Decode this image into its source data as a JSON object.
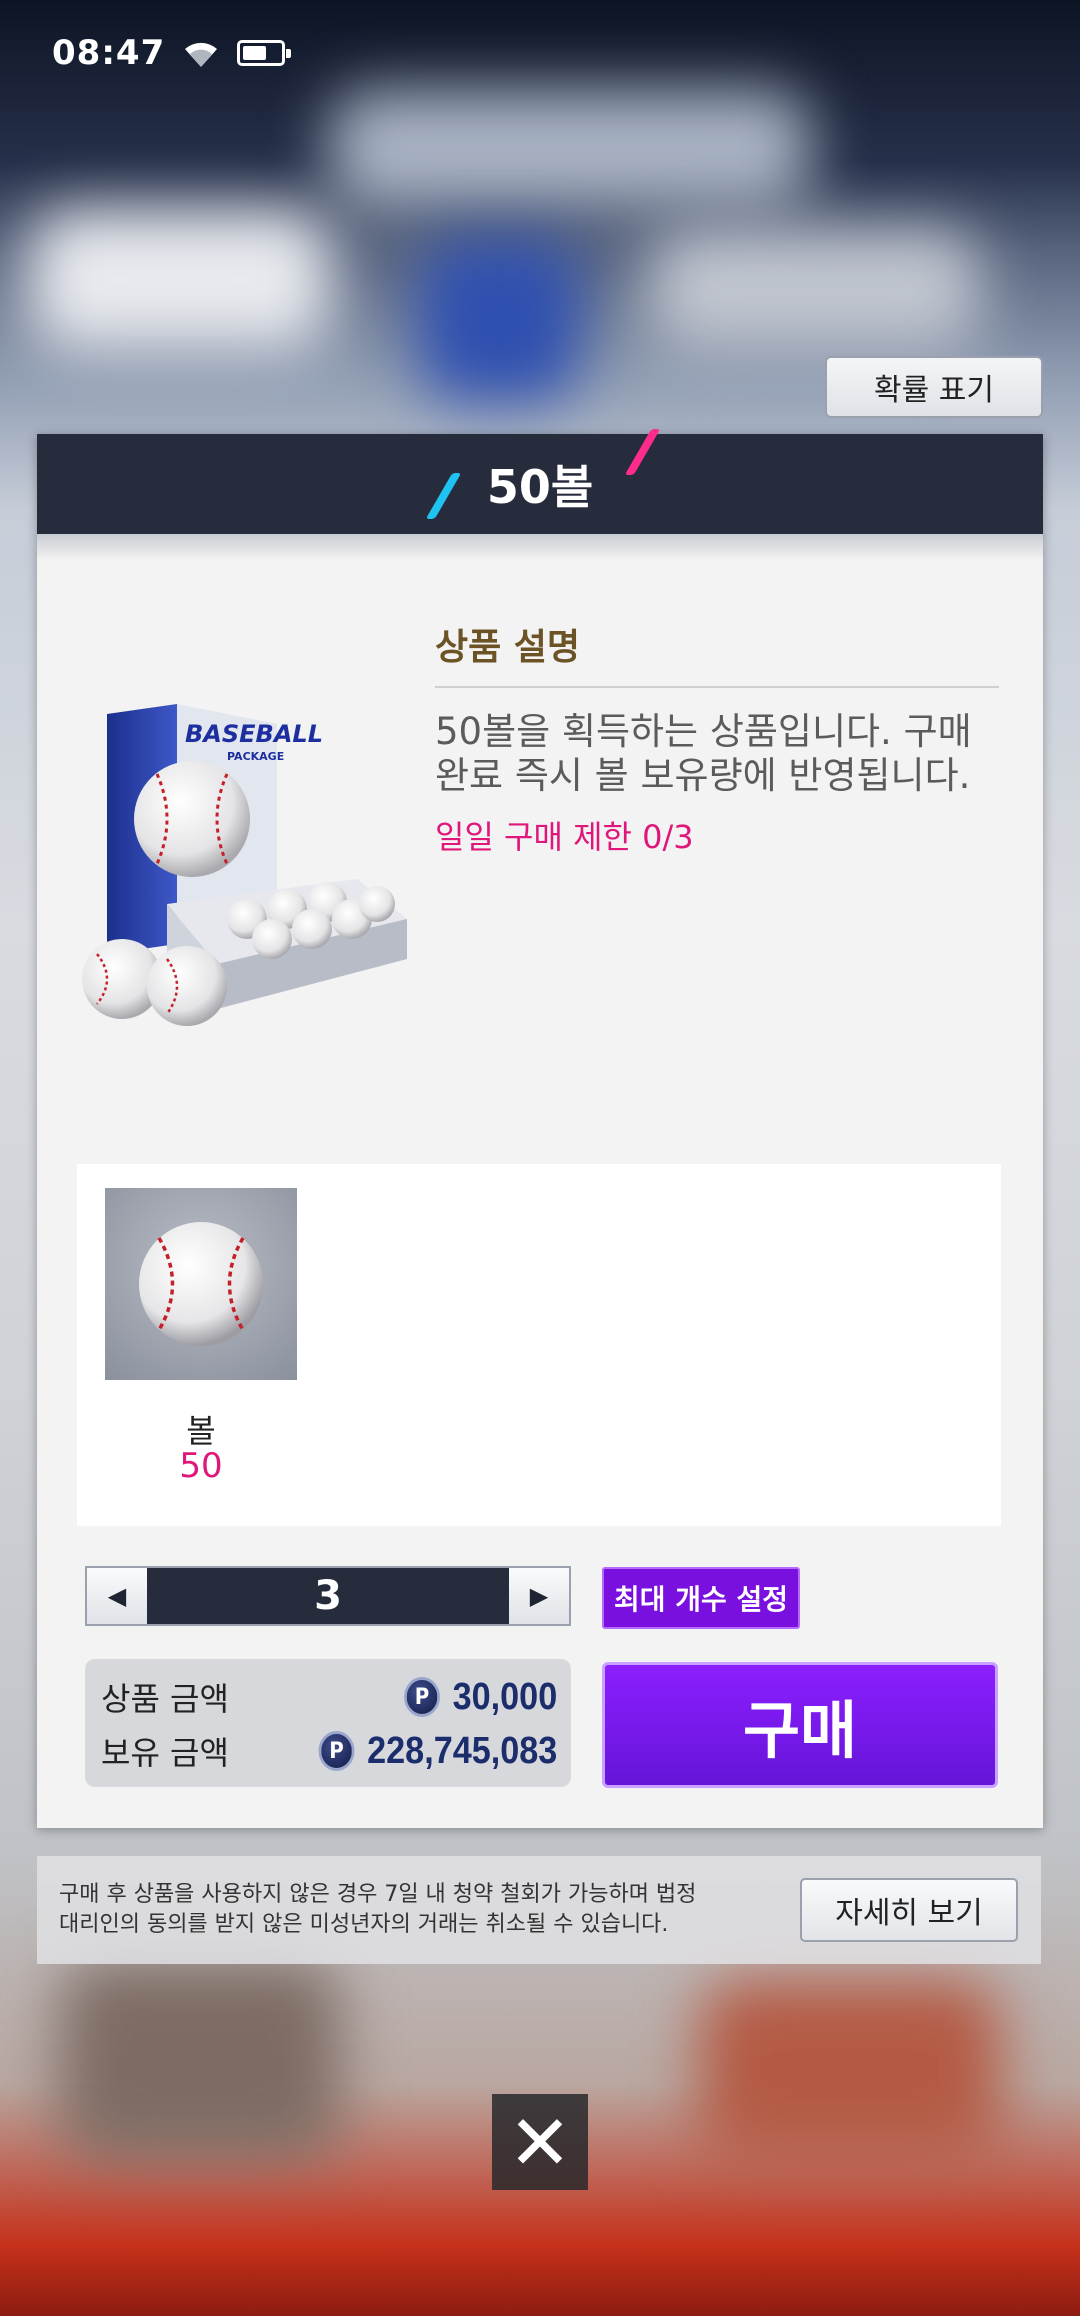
{
  "status_bar": {
    "time": "08:47"
  },
  "probability_button": "확률 표기",
  "panel": {
    "title": "50볼",
    "description_title": "상품 설명",
    "description_text": "50볼을 획득하는 상품입니다. 구매 완료 즉시 볼 보유량에 반영됩니다.",
    "daily_limit": "일일 구매 제한 0/3",
    "product_image": {
      "brand": "BASEBALL",
      "sub": "PACKAGE"
    },
    "reward": {
      "name": "볼",
      "quantity": "50"
    },
    "quantity": {
      "value": "3",
      "max_button": "최대 개수 설정"
    },
    "price": {
      "label": "상품 금액",
      "value": "30,000"
    },
    "balance": {
      "label": "보유 금액",
      "value": "228,745,083"
    },
    "coin_symbol": "P",
    "buy_button": "구매"
  },
  "notice": {
    "text": "구매 후 상품을 사용하지 않은 경우 7일 내 청약 철회가 가능하며 법정 대리인의 동의를 받지 않은 미성년자의 거래는 취소될 수 있습니다.",
    "detail_button": "자세히 보기"
  },
  "colors": {
    "accent_purple": "#7a10e0",
    "pink": "#e0177a",
    "header_navy": "#272c3d"
  },
  "icons": [
    "wifi-icon",
    "battery-icon",
    "baseball-icon",
    "arrow-left-icon",
    "arrow-right-icon",
    "coin-icon",
    "close-icon"
  ]
}
